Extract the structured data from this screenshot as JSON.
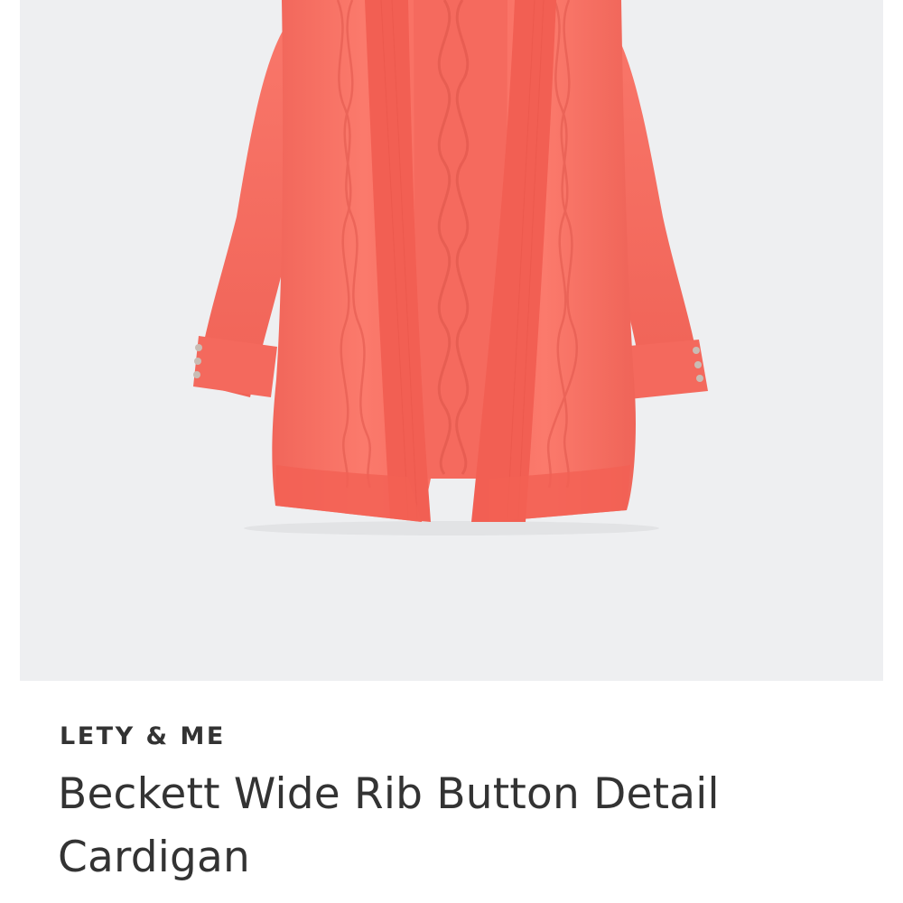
{
  "product": {
    "brand": "LETY & ME",
    "name": "Beckett Wide Rib Button Detail Cardigan",
    "image": {
      "subject": "coral open-front cardigan",
      "background_color": "#eeeff1",
      "garment_color": "#f86e62"
    }
  }
}
